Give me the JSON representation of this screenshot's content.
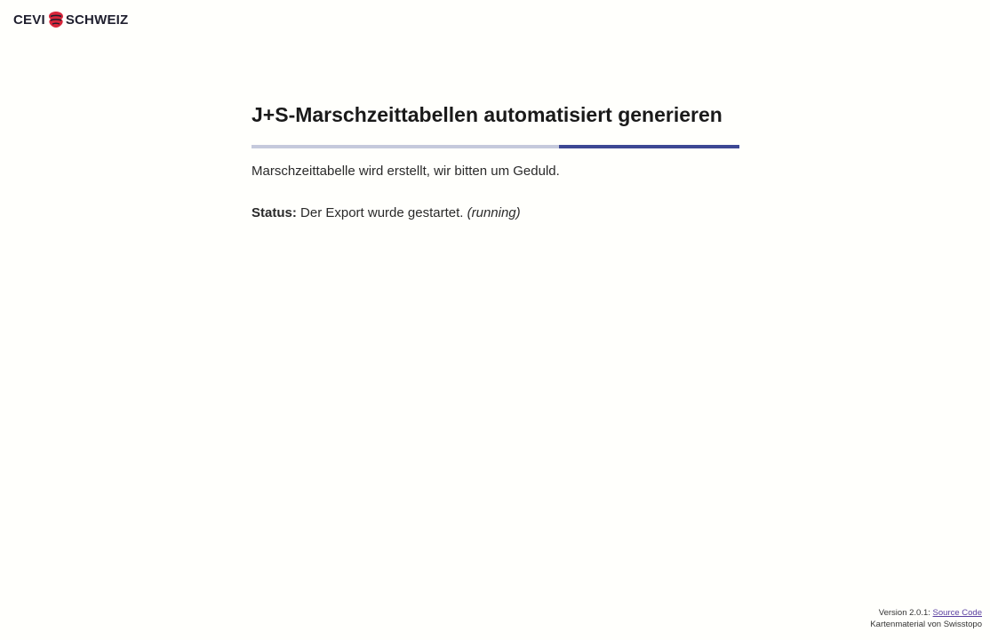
{
  "header": {
    "logo_left": "CEVI",
    "logo_right": "SCHWEIZ",
    "logo_icon": "cevi-logo-icon"
  },
  "main": {
    "title": "J+S-Marschzeittabellen automatisiert generieren",
    "progress_fraction": 0.37,
    "progress_colors": {
      "track": "#c5c9dc",
      "fill": "#3d4894"
    },
    "info_text": "Marschzeittabelle wird erstellt, wir bitten um Geduld.",
    "status": {
      "label": "Status:",
      "message": "Der Export wurde gestartet.",
      "code": "(running)"
    }
  },
  "footer": {
    "version": "Version 2.0.1:",
    "source_link": "Source Code",
    "map_credit": "Kartenmaterial von Swisstopo"
  }
}
